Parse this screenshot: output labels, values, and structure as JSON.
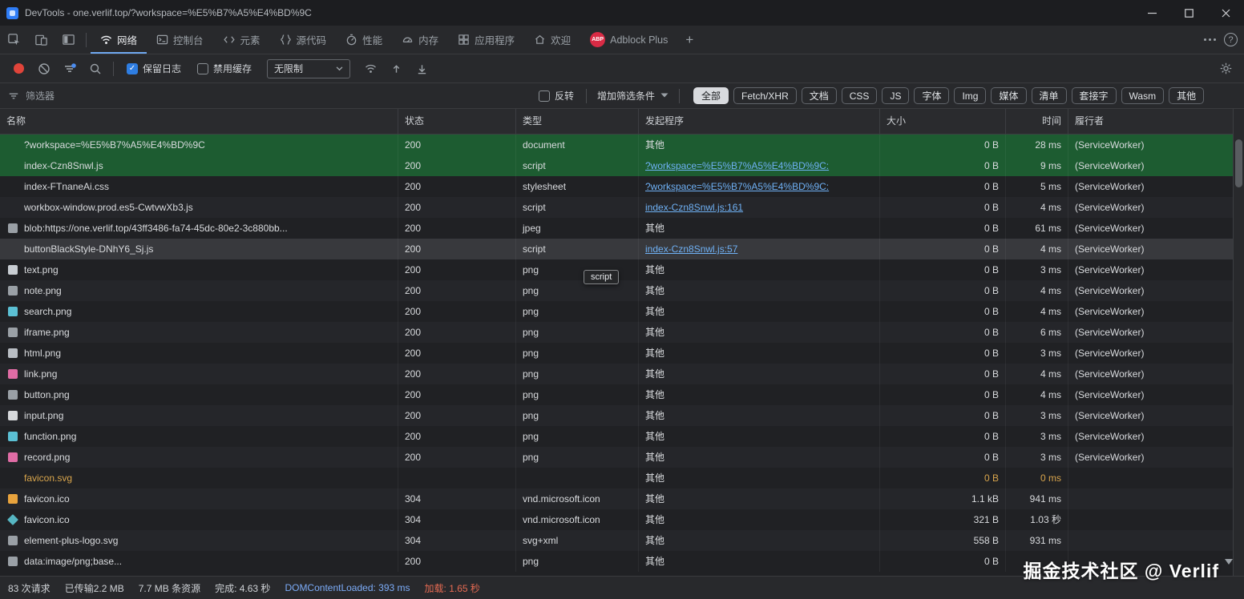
{
  "window": {
    "title": "DevTools - one.verlif.top/?workspace=%E5%B7%A5%E4%BD%9C"
  },
  "tabs": {
    "abp_badge": "ABP",
    "add_label": "+",
    "items": [
      {
        "name": "network",
        "label": "网络",
        "icon": "network-icon",
        "selected": true
      },
      {
        "name": "console",
        "label": "控制台",
        "icon": "console-icon",
        "selected": false
      },
      {
        "name": "elements",
        "label": "元素",
        "icon": "elements-icon",
        "selected": false
      },
      {
        "name": "sources",
        "label": "源代码",
        "icon": "sources-icon",
        "selected": false
      },
      {
        "name": "performance",
        "label": "性能",
        "icon": "performance-icon",
        "selected": false
      },
      {
        "name": "memory",
        "label": "内存",
        "icon": "memory-icon",
        "selected": false
      },
      {
        "name": "application",
        "label": "应用程序",
        "icon": "application-icon",
        "selected": false
      },
      {
        "name": "welcome",
        "label": "欢迎",
        "icon": "welcome-icon",
        "selected": false
      },
      {
        "name": "adblock-plus",
        "label": "Adblock Plus",
        "icon": "abp-icon",
        "selected": false
      }
    ]
  },
  "toolbar": {
    "preserve_log_label": "保留日志",
    "preserve_log_checked": true,
    "disable_cache_label": "禁用缓存",
    "disable_cache_checked": false,
    "throttling_value": "无限制"
  },
  "filter_bar": {
    "placeholder": "筛选器",
    "invert_label": "反转",
    "more_filters_label": "增加筛选条件",
    "pills": [
      {
        "name": "all",
        "label": "全部",
        "selected": true
      },
      {
        "name": "fetch-xhr",
        "label": "Fetch/XHR",
        "selected": false
      },
      {
        "name": "doc",
        "label": "文档",
        "selected": false
      },
      {
        "name": "css",
        "label": "CSS",
        "selected": false
      },
      {
        "name": "js",
        "label": "JS",
        "selected": false
      },
      {
        "name": "font",
        "label": "字体",
        "selected": false
      },
      {
        "name": "img",
        "label": "Img",
        "selected": false
      },
      {
        "name": "media",
        "label": "媒体",
        "selected": false
      },
      {
        "name": "manifest",
        "label": "清单",
        "selected": false
      },
      {
        "name": "socket",
        "label": "套接字",
        "selected": false
      },
      {
        "name": "wasm",
        "label": "Wasm",
        "selected": false
      },
      {
        "name": "other",
        "label": "其他",
        "selected": false
      }
    ]
  },
  "table": {
    "columns": [
      {
        "name": "name",
        "label": "名称"
      },
      {
        "name": "status",
        "label": "状态"
      },
      {
        "name": "type",
        "label": "类型"
      },
      {
        "name": "initiator",
        "label": "发起程序"
      },
      {
        "name": "size",
        "label": "大小"
      },
      {
        "name": "time",
        "label": "时间"
      },
      {
        "name": "fulfilled-by",
        "label": "履行者"
      }
    ],
    "rows": [
      {
        "name": "?workspace=%E5%B7%A5%E4%BD%9C",
        "icon": null,
        "status": "200",
        "type": "document",
        "initiator": "其他",
        "link": false,
        "size": "0 B",
        "time": "28 ms",
        "fulfilled": "(ServiceWorker)",
        "state": "new"
      },
      {
        "name": "index-Czn8Snwl.js",
        "icon": null,
        "status": "200",
        "type": "script",
        "initiator": "?workspace=%E5%B7%A5%E4%BD%9C:",
        "link": true,
        "size": "0 B",
        "time": "9 ms",
        "fulfilled": "(ServiceWorker)",
        "state": "new"
      },
      {
        "name": "index-FTnaneAi.css",
        "icon": null,
        "status": "200",
        "type": "stylesheet",
        "initiator": "?workspace=%E5%B7%A5%E4%BD%9C:",
        "link": true,
        "size": "0 B",
        "time": "5 ms",
        "fulfilled": "(ServiceWorker)",
        "state": ""
      },
      {
        "name": "workbox-window.prod.es5-CwtvwXb3.js",
        "icon": null,
        "status": "200",
        "type": "script",
        "initiator": "index-Czn8Snwl.js:161",
        "link": true,
        "size": "0 B",
        "time": "4 ms",
        "fulfilled": "(ServiceWorker)",
        "state": ""
      },
      {
        "name": "blob:https://one.verlif.top/43ff3486-fa74-45dc-80e2-3c880bb...",
        "icon": "#9aa0a6",
        "status": "200",
        "type": "jpeg",
        "initiator": "其他",
        "link": false,
        "size": "0 B",
        "time": "61 ms",
        "fulfilled": "(ServiceWorker)",
        "state": ""
      },
      {
        "name": "buttonBlackStyle-DNhY6_Sj.js",
        "icon": null,
        "status": "200",
        "type": "script",
        "initiator": "index-Czn8Snwl.js:57",
        "link": true,
        "size": "0 B",
        "time": "4 ms",
        "fulfilled": "(ServiceWorker)",
        "state": "hover"
      },
      {
        "name": "text.png",
        "icon": "#c8cdd2",
        "status": "200",
        "type": "png",
        "initiator": "其他",
        "link": false,
        "size": "0 B",
        "time": "3 ms",
        "fulfilled": "(ServiceWorker)",
        "state": ""
      },
      {
        "name": "note.png",
        "icon": "#9aa0a6",
        "status": "200",
        "type": "png",
        "initiator": "其他",
        "link": false,
        "size": "0 B",
        "time": "4 ms",
        "fulfilled": "(ServiceWorker)",
        "state": ""
      },
      {
        "name": "search.png",
        "icon": "#5bc0d4",
        "status": "200",
        "type": "png",
        "initiator": "其他",
        "link": false,
        "size": "0 B",
        "time": "4 ms",
        "fulfilled": "(ServiceWorker)",
        "state": ""
      },
      {
        "name": "iframe.png",
        "icon": "#9aa0a6",
        "status": "200",
        "type": "png",
        "initiator": "其他",
        "link": false,
        "size": "0 B",
        "time": "6 ms",
        "fulfilled": "(ServiceWorker)",
        "state": ""
      },
      {
        "name": "html.png",
        "icon": "#b9bec4",
        "status": "200",
        "type": "png",
        "initiator": "其他",
        "link": false,
        "size": "0 B",
        "time": "3 ms",
        "fulfilled": "(ServiceWorker)",
        "state": ""
      },
      {
        "name": "link.png",
        "icon": "#e06ca5",
        "status": "200",
        "type": "png",
        "initiator": "其他",
        "link": false,
        "size": "0 B",
        "time": "4 ms",
        "fulfilled": "(ServiceWorker)",
        "state": ""
      },
      {
        "name": "button.png",
        "icon": "#9aa0a6",
        "status": "200",
        "type": "png",
        "initiator": "其他",
        "link": false,
        "size": "0 B",
        "time": "4 ms",
        "fulfilled": "(ServiceWorker)",
        "state": ""
      },
      {
        "name": "input.png",
        "icon": "#d7d9dc",
        "status": "200",
        "type": "png",
        "initiator": "其他",
        "link": false,
        "size": "0 B",
        "time": "3 ms",
        "fulfilled": "(ServiceWorker)",
        "state": ""
      },
      {
        "name": "function.png",
        "icon": "#5bc0d4",
        "status": "200",
        "type": "png",
        "initiator": "其他",
        "link": false,
        "size": "0 B",
        "time": "3 ms",
        "fulfilled": "(ServiceWorker)",
        "state": ""
      },
      {
        "name": "record.png",
        "icon": "#e06ca5",
        "status": "200",
        "type": "png",
        "initiator": "其他",
        "link": false,
        "size": "0 B",
        "time": "3 ms",
        "fulfilled": "(ServiceWorker)",
        "state": ""
      },
      {
        "name": "favicon.svg",
        "icon": null,
        "status": "",
        "type": "",
        "initiator": "其他",
        "link": false,
        "size": "0 B",
        "time": "0 ms",
        "fulfilled": "",
        "state": "pending"
      },
      {
        "name": "favicon.ico",
        "icon": "#e8a33d",
        "status": "304",
        "type": "vnd.microsoft.icon",
        "initiator": "其他",
        "link": false,
        "size": "1.1 kB",
        "time": "941 ms",
        "fulfilled": "",
        "state": ""
      },
      {
        "name": "favicon.ico",
        "icon": "#56b6c2",
        "icon_shape": "diamond",
        "status": "304",
        "type": "vnd.microsoft.icon",
        "initiator": "其他",
        "link": false,
        "size": "321 B",
        "time": "1.03 秒",
        "fulfilled": "",
        "state": ""
      },
      {
        "name": "element-plus-logo.svg",
        "icon": "#9aa0a6",
        "status": "304",
        "type": "svg+xml",
        "initiator": "其他",
        "link": false,
        "size": "558 B",
        "time": "931 ms",
        "fulfilled": "",
        "state": ""
      },
      {
        "name": "data:image/png;base...",
        "icon": "#9aa0a6",
        "status": "200",
        "type": "png",
        "initiator": "其他",
        "link": false,
        "size": "0 B",
        "time": "",
        "fulfilled": "",
        "state": ""
      }
    ]
  },
  "tooltip": {
    "text": "script"
  },
  "status_bar": {
    "requests": "83 次请求",
    "transferred": "已传输2.2 MB",
    "resources": "7.7 MB 条资源",
    "finish": "完成: 4.63 秒",
    "dom_content_loaded": "DOMContentLoaded: 393 ms",
    "load": "加载: 1.65 秒"
  },
  "watermark": {
    "text": "掘金技术社区 @ Verlif"
  },
  "colors": {
    "accent_blue": "#6fa8f0",
    "row_new_green": "#1d5c31",
    "pending_orange": "#d8a54c",
    "link_blue": "#6fb1f5",
    "record_red": "#e0443a",
    "checkbox_blue": "#2e7de1"
  }
}
